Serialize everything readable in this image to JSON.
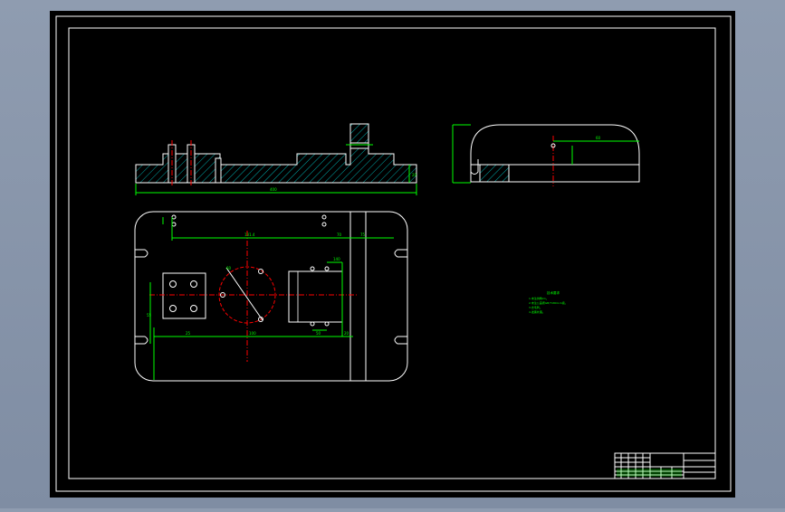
{
  "drawing": {
    "background_color": "#000000",
    "outline_color": "#ffffff",
    "dimension_color": "#00ff00",
    "centerline_color": "#ff0000",
    "hatch_color": "#00aaaa"
  },
  "dimensions": {
    "front_total_length": "400",
    "front_height": "20",
    "side_width": "60",
    "top_a": "131.4",
    "top_b": "70",
    "top_c": "75",
    "top_d": "55",
    "top_e": "25",
    "top_f": "100",
    "top_g": "20",
    "top_h": "50",
    "top_i": "140",
    "top_j": "60"
  },
  "technical_requirements": {
    "heading": "技术要求",
    "lines": [
      "1.未注倒角C1。",
      "2.未注公差按GB/T1804-m级。",
      "3.去毛刺。",
      "4.发黑处理。"
    ]
  },
  "title_block": {
    "cells": [
      "",
      "",
      "",
      "",
      "",
      "",
      "",
      "",
      "",
      "",
      ""
    ]
  }
}
